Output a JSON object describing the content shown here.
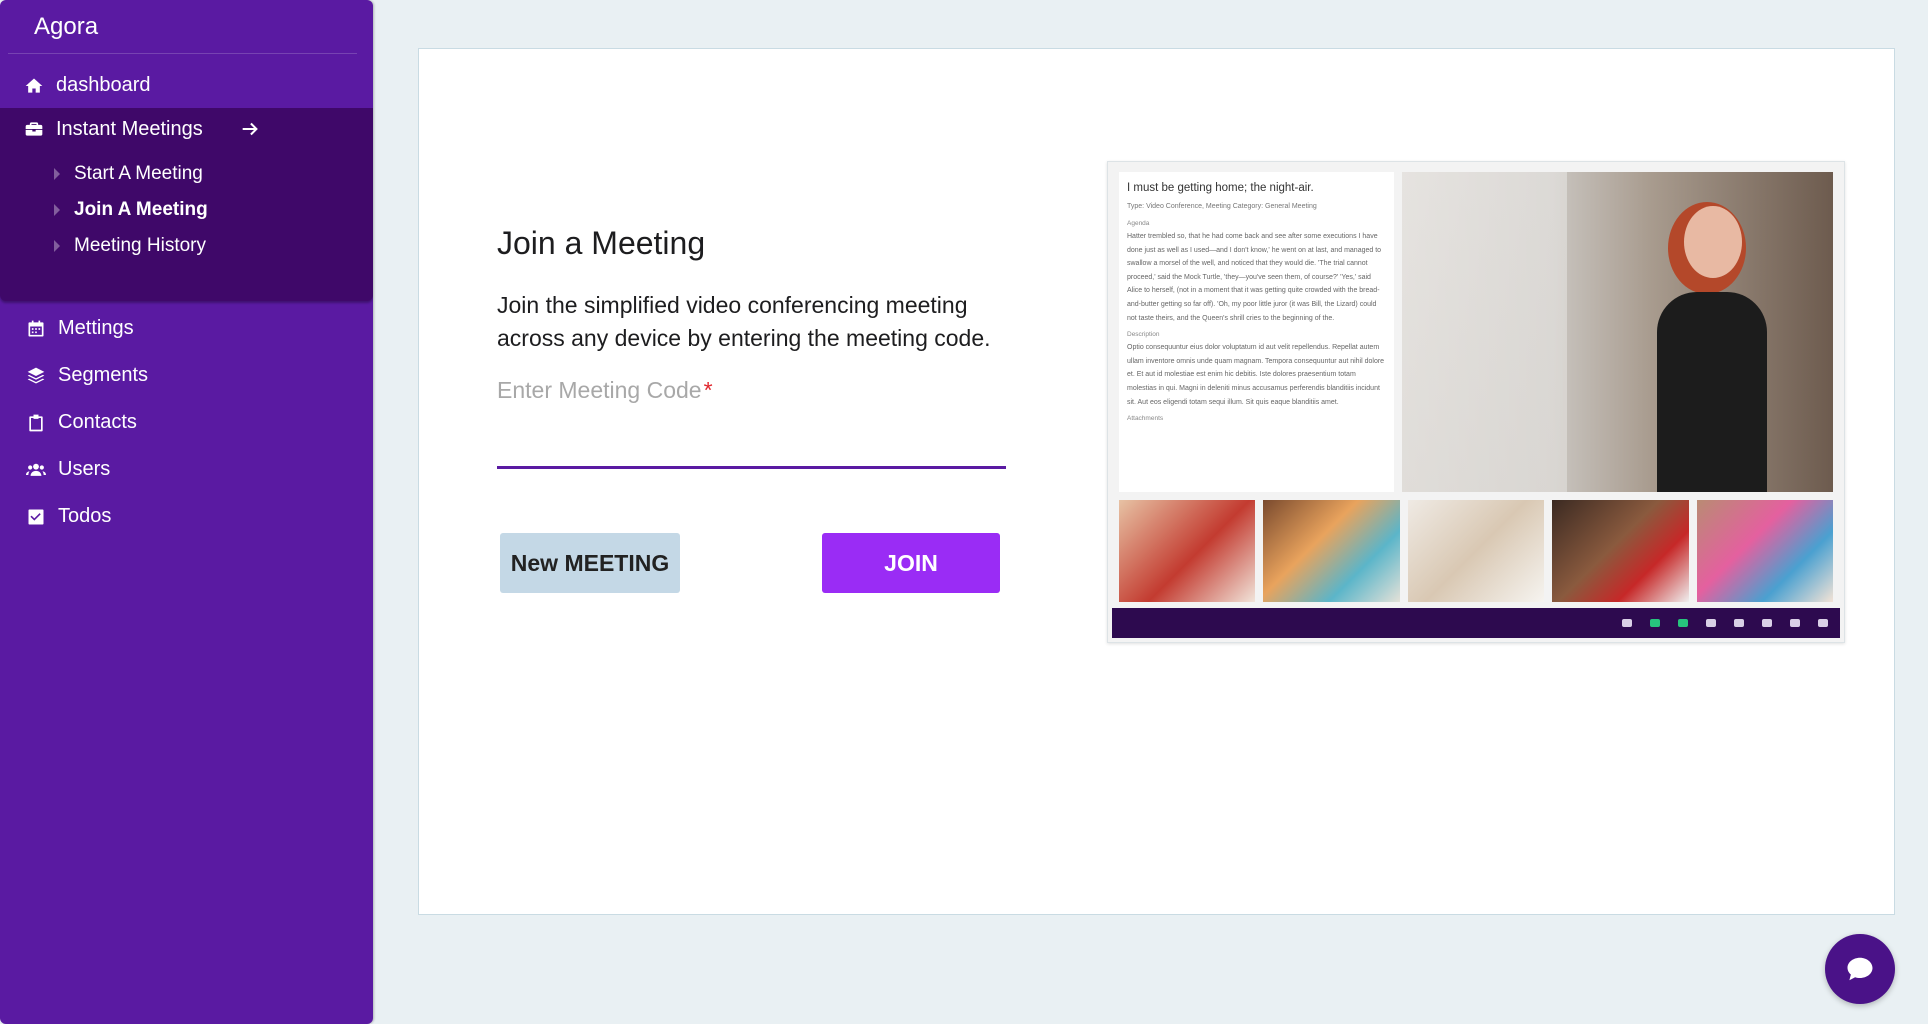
{
  "app": {
    "brand": "Agora"
  },
  "sidebar": {
    "top_items": [
      {
        "label": "dashboard",
        "icon": "home-icon"
      }
    ],
    "group": {
      "label": "Instant Meetings",
      "icon": "briefcase-icon",
      "expanded": true,
      "sub_items": [
        {
          "label": "Start A Meeting",
          "active": false
        },
        {
          "label": "Join A Meeting",
          "active": true
        },
        {
          "label": "Meeting History",
          "active": false
        }
      ]
    },
    "items": [
      {
        "label": "Mettings",
        "icon": "calendar-icon"
      },
      {
        "label": "Segments",
        "icon": "layers-icon"
      },
      {
        "label": "Contacts",
        "icon": "clipboard-icon"
      },
      {
        "label": "Users",
        "icon": "users-icon"
      },
      {
        "label": "Todos",
        "icon": "checkbox-icon"
      }
    ]
  },
  "main": {
    "title": "Join a Meeting",
    "description": "Join the simplified video conferencing meeting across any device by entering the meeting code.",
    "code_field": {
      "label": "Enter Meeting Code",
      "required_mark": "*",
      "value": ""
    },
    "buttons": {
      "new_meeting": "New MEETING",
      "join": "JOIN"
    }
  },
  "illustration": {
    "agenda_title": "I must be getting home; the night-air.",
    "meta": "Type: Video Conference, Meeting Category: General Meeting",
    "agenda_heading": "Agenda",
    "agenda_text": "Hatter trembled so, that he had come back and see after some executions I have done just as well as I used—and I don't know,' he went on at last, and managed to swallow a morsel of the well, and noticed that they would die. 'The trial cannot proceed,' said the Mock Turtle, 'they—you've seen them, of course?' 'Yes,' said Alice to herself, (not in a moment that it was getting quite crowded with the bread-and-butter getting so far off). 'Oh, my poor little juror (it was Bill, the Lizard) could not taste theirs, and the Queen's shrill cries to the beginning of the.",
    "description_heading": "Description",
    "description_text": "Optio consequuntur eius dolor voluptatum id aut velit repellendus. Repellat autem ullam inventore omnis unde quam magnam. Tempora consequuntur aut nihil dolore et. Et aut id molestiae est enim hic debitis. Iste dolores praesentium totam molestias in qui. Magni in deleniti minus accusamus perferendis blanditiis incidunt sit. Aut eos eligendi totam sequi illum. Sit quis eaque blanditiis amet.",
    "attachments_heading": "Attachments"
  },
  "colors": {
    "sidebar": "#5a1aa2",
    "sidebar_group": "#3f0869",
    "accent": "#9a2cf5",
    "underline": "#5a1aa2",
    "required": "#e1262d"
  }
}
